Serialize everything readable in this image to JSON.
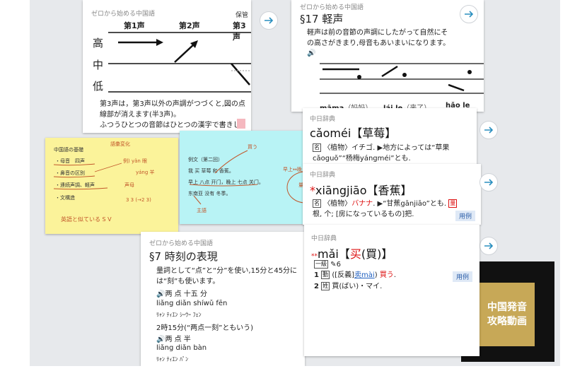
{
  "card_tone": {
    "title": "ゼロから始める中国語",
    "badge": "保管",
    "tone_labels": [
      "第1声",
      "第2声",
      "第3声"
    ],
    "levels": [
      "高",
      "中",
      "低"
    ],
    "body_lines": [
      "第3声は，第3声以外の声調がつづくと,図の点",
      "線部が消えます(半3声)。",
      "ふつうひとつの音節はひとつの漢字で書きし"
    ]
  },
  "card_neutral": {
    "title": "ゼロから始める中国語",
    "heading": "§17 軽声",
    "body_lines": [
      "軽声は前の音節の声調にしたがって自然にそ",
      "の高さがきまり,母音もあいまいになります。"
    ],
    "examples": [
      {
        "pinyin": "māma",
        "hanzi": "（妈妈）"
      },
      {
        "pinyin": "lái  le",
        "hanzi": "（来了）"
      },
      {
        "pinyin": "hǎo  le",
        "hanzi": ""
      }
    ]
  },
  "note_yellow": {
    "lines": [
      "中国語の基礎",
      "・母音　四声",
      "・鼻音の区別",
      "・連続声調、軽声",
      "・文構造"
    ],
    "scribbles": [
      "語彙変化",
      "例) yǎn 眼",
      "yáng 羊",
      "声母",
      "3 3 (→2 3)",
      "英語と似ている  S V"
    ]
  },
  "note_cyan": {
    "lines": [
      "例文（第二回）",
      "我 买 草莓 和 香蕉。",
      "早上 八点 开门，晚上 七点 关门。",
      "东南亚 没有 冬季。"
    ],
    "scribbles": [
      "買う",
      "早上↔晚上",
      "量詞",
      "主語"
    ]
  },
  "dict1": {
    "title": "中日辞典",
    "headword_pinyin": "cǎoméi",
    "headword_hanzi": "【草莓】",
    "pos": "名",
    "line1": "〈植物〉イチゴ. ▶地方によっては“草果",
    "line2": "cǎoguǒ”“杨梅yángméi”とも."
  },
  "dict2": {
    "title": "中日辞典",
    "star": "*",
    "headword_pinyin": "xiāngjiāo",
    "headword_hanzi": "【香蕉】",
    "pos": "名",
    "line1_a": "〈植物〉",
    "line1_red": "バナナ",
    "line1_b": ". ▶“甘蕉gānjiāo”とも.",
    "line1_badge": "量",
    "line2": "根, 个; [房になっているもの]把.",
    "tag": "用例"
  },
  "dict3": {
    "title": "中日辞典",
    "star": "**",
    "headword_pinyin": "mǎi",
    "headword_hanzi_red": "买",
    "headword_hanzi_trad": "(買)",
    "level": "一級",
    "strokes": "6",
    "sense1_num": "1",
    "sense1_pos": "動",
    "sense1_text": "([反義]",
    "sense1_link": "卖mài",
    "sense1_red": "買う",
    "sense2_num": "2",
    "sense2_pos": "姓",
    "sense2_text": "買(ばい)・マイ.",
    "tag": "用例"
  },
  "card_time": {
    "title": "ゼロから始める中国語",
    "heading": "§7 時刻の表現",
    "lines": [
      "量詞として“点”と“分”を使い,15分と45分に",
      "は“刻”も使います。"
    ],
    "ex1_audio": "两 点 十五 分",
    "ex1_pinyin": "liǎng diǎn shíwǔ fēn",
    "ex1_kana": "ﾘｬﾝ ﾃｨｴﾝ ｼｰｳｰ ﾌｪﾝ",
    "ex2_text": "2時15分(“两点一刻”ともいう)",
    "ex3_audio": "两 点 半",
    "ex3_pinyin": "liǎng diǎn bàn",
    "ex3_kana": "ﾘｬﾝ ﾃｨｴﾝ ﾊﾟﾝ"
  },
  "promo": {
    "line1": "中国発音",
    "line2": "攻略動画"
  },
  "icons": [
    "arrow-right-icon",
    "speaker-icon"
  ]
}
